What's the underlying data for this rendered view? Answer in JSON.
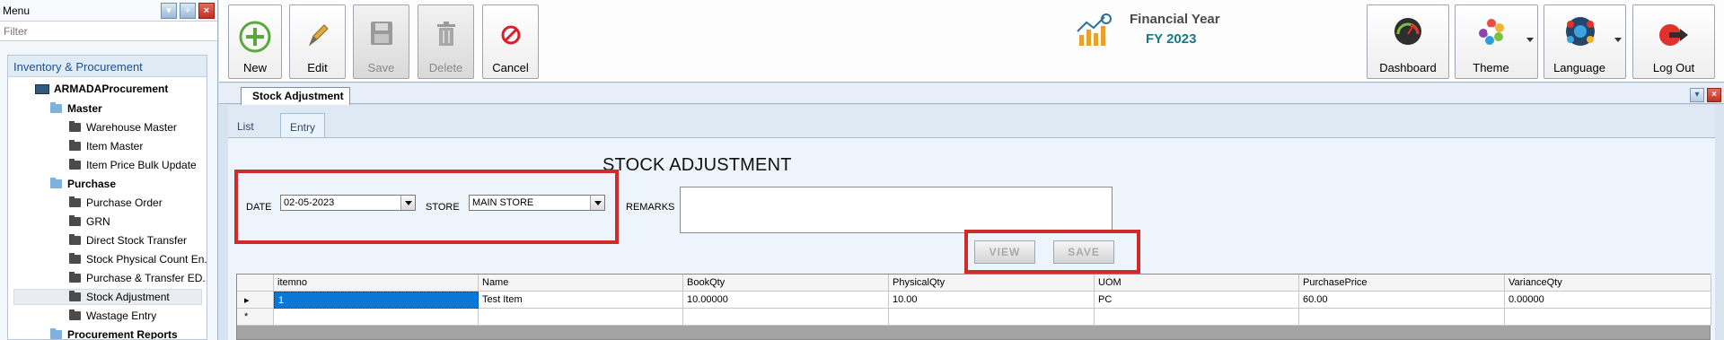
{
  "menu": {
    "title": "Menu",
    "filter_placeholder": "Filter",
    "section": "Inventory & Procurement",
    "tree": {
      "root": "ARMADAProcurement",
      "master": "Master",
      "master_items": [
        "Warehouse Master",
        "Item Master",
        "Item Price Bulk Update"
      ],
      "purchase": "Purchase",
      "purchase_items": [
        "Purchase Order",
        "GRN",
        "Direct Stock Transfer",
        "Stock Physical Count En...",
        "Purchase & Transfer ED...",
        "Stock Adjustment",
        "Wastage Entry"
      ],
      "reports": "Procurement Reports"
    }
  },
  "toolbar": {
    "new": "New",
    "edit": "Edit",
    "save": "Save",
    "delete": "Delete",
    "cancel": "Cancel",
    "dashboard": "Dashboard",
    "theme": "Theme",
    "language": "Language",
    "logout": "Log Out"
  },
  "financial_year": {
    "label": "Financial Year",
    "value": "FY 2023"
  },
  "document": {
    "tab": "Stock Adjustment",
    "inner_tabs": [
      "List",
      "Entry"
    ],
    "active_inner_tab": "Entry"
  },
  "form": {
    "title": "STOCK ADJUSTMENT",
    "date_label": "DATE",
    "date_value": "02-05-2023",
    "store_label": "STORE",
    "store_value": "MAIN STORE",
    "remarks_label": "REMARKS",
    "remarks_value": "",
    "view_button": "VIEW",
    "save_button": "SAVE"
  },
  "grid": {
    "columns": [
      "itemno",
      "Name",
      "BookQty",
      "PhysicalQty",
      "UOM",
      "PurchasePrice",
      "VarianceQty"
    ],
    "rows": [
      [
        "1",
        "Test Item",
        "10.00000",
        "10.00",
        "PC",
        "60.00",
        "0.00000"
      ]
    ],
    "new_row_marker": "*"
  },
  "colors": {
    "accent": "#157a88",
    "highlight": "#d02b2b",
    "selection": "#0a77d6"
  }
}
